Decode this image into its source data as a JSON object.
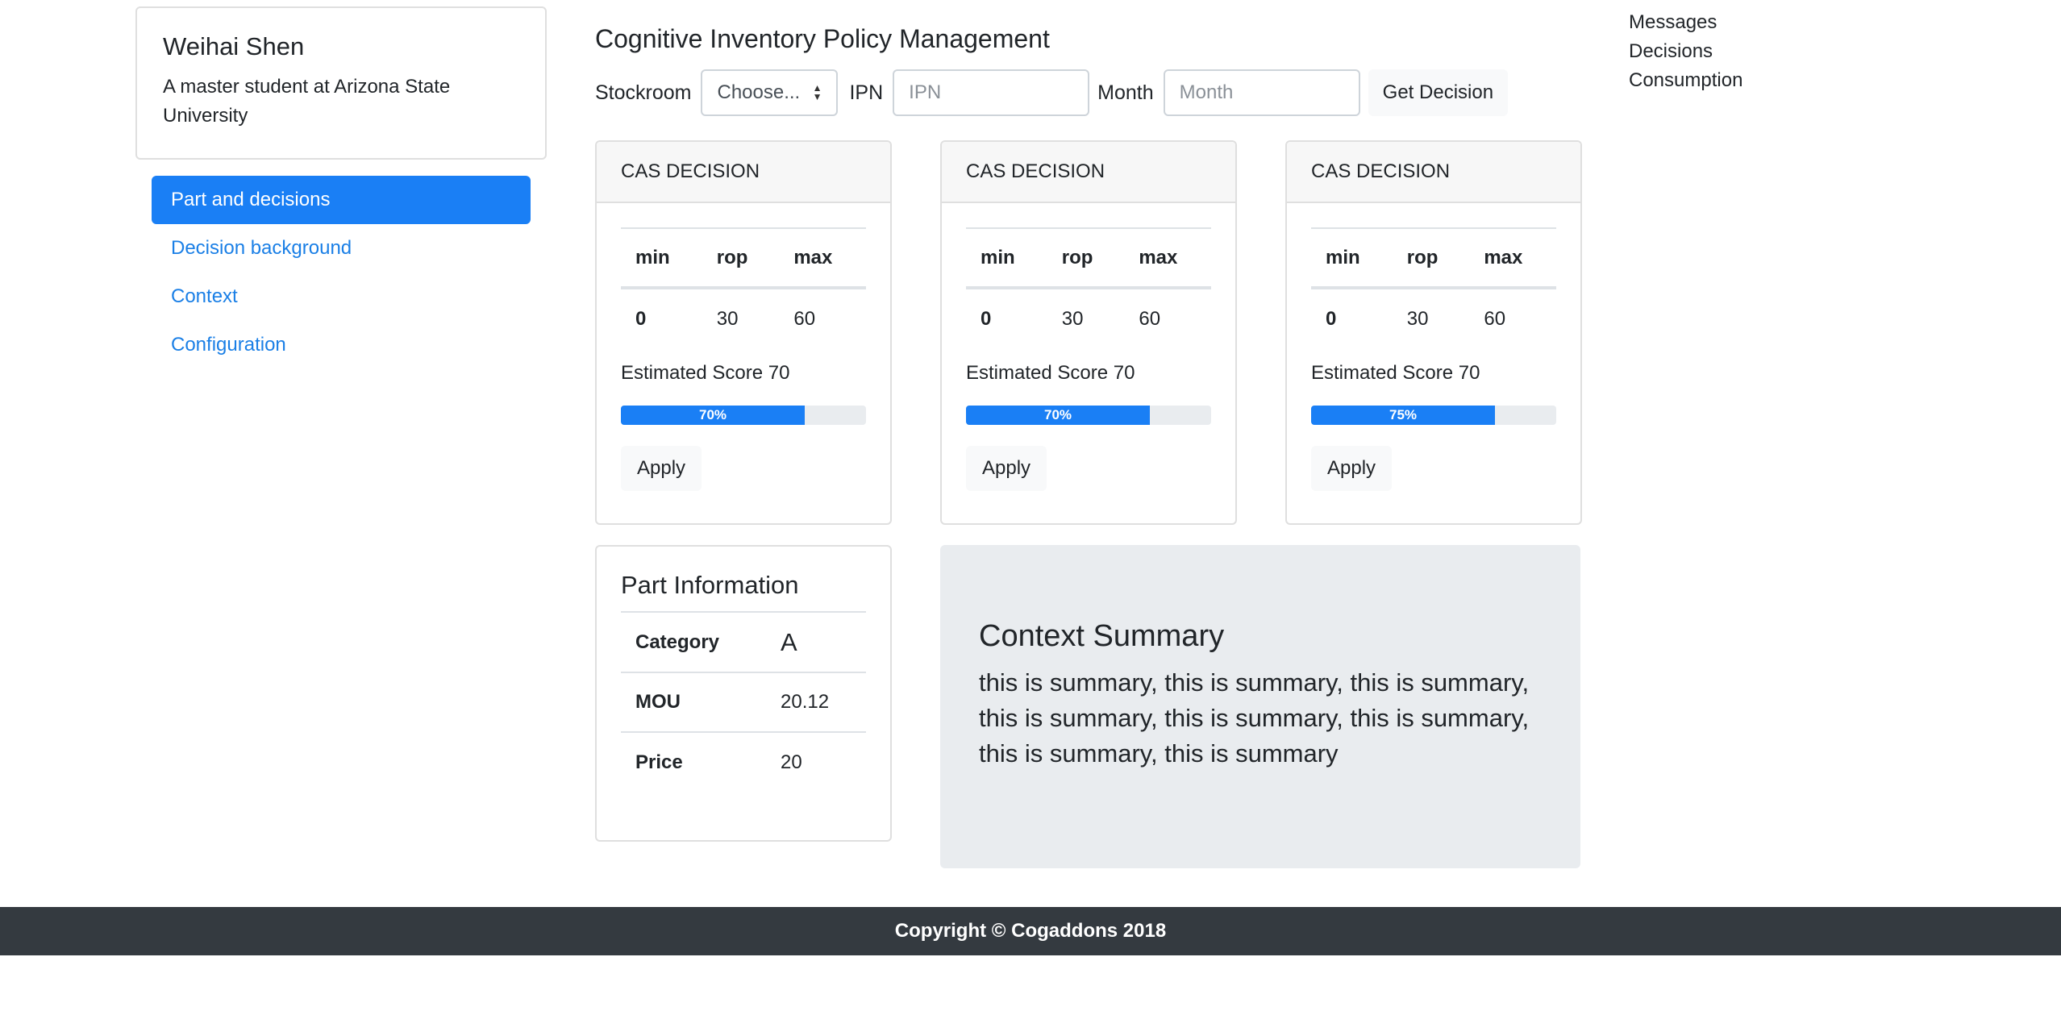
{
  "profile": {
    "name": "Weihai Shen",
    "description": "A master student at Arizona State University"
  },
  "sidebar": {
    "items": [
      {
        "label": "Part and decisions",
        "active": true
      },
      {
        "label": "Decision background",
        "active": false
      },
      {
        "label": "Context",
        "active": false
      },
      {
        "label": "Configuration",
        "active": false
      }
    ]
  },
  "header": {
    "title": "Cognitive Inventory Policy Management"
  },
  "form": {
    "stockroom_label": "Stockroom",
    "stockroom_value": "Choose...",
    "ipn_label": "IPN",
    "ipn_placeholder": "IPN",
    "month_label": "Month",
    "month_placeholder": "Month",
    "submit_label": "Get Decision"
  },
  "decisions": [
    {
      "header": "CAS DECISION",
      "columns": [
        "min",
        "rop",
        "max"
      ],
      "values": [
        "0",
        "30",
        "60"
      ],
      "score_label": "Estimated Score 70",
      "progress": 75,
      "progress_label": "70%",
      "apply_label": "Apply"
    },
    {
      "header": "CAS DECISION",
      "columns": [
        "min",
        "rop",
        "max"
      ],
      "values": [
        "0",
        "30",
        "60"
      ],
      "score_label": "Estimated Score 70",
      "progress": 75,
      "progress_label": "70%",
      "apply_label": "Apply"
    },
    {
      "header": "CAS DECISION",
      "columns": [
        "min",
        "rop",
        "max"
      ],
      "values": [
        "0",
        "30",
        "60"
      ],
      "score_label": "Estimated Score 70",
      "progress": 75,
      "progress_label": "75%",
      "apply_label": "Apply"
    }
  ],
  "part_info": {
    "title": "Part Information",
    "rows": [
      {
        "key": "Category",
        "value": "A"
      },
      {
        "key": "MOU",
        "value": "20.12"
      },
      {
        "key": "Price",
        "value": "20"
      }
    ]
  },
  "summary": {
    "title": "Context Summary",
    "text": "this is summary, this is summary, this is summary, this is summary, this is summary, this is summary, this is summary, this is summary"
  },
  "right_links": [
    "Messages",
    "Decisions",
    "Consumption"
  ],
  "footer": {
    "text": "Copyright © Cogaddons 2018"
  },
  "colors": {
    "primary": "#1a7ff5",
    "link": "#1a7fe6",
    "footer_bg": "#343a40",
    "summary_bg": "#e9ecef"
  }
}
